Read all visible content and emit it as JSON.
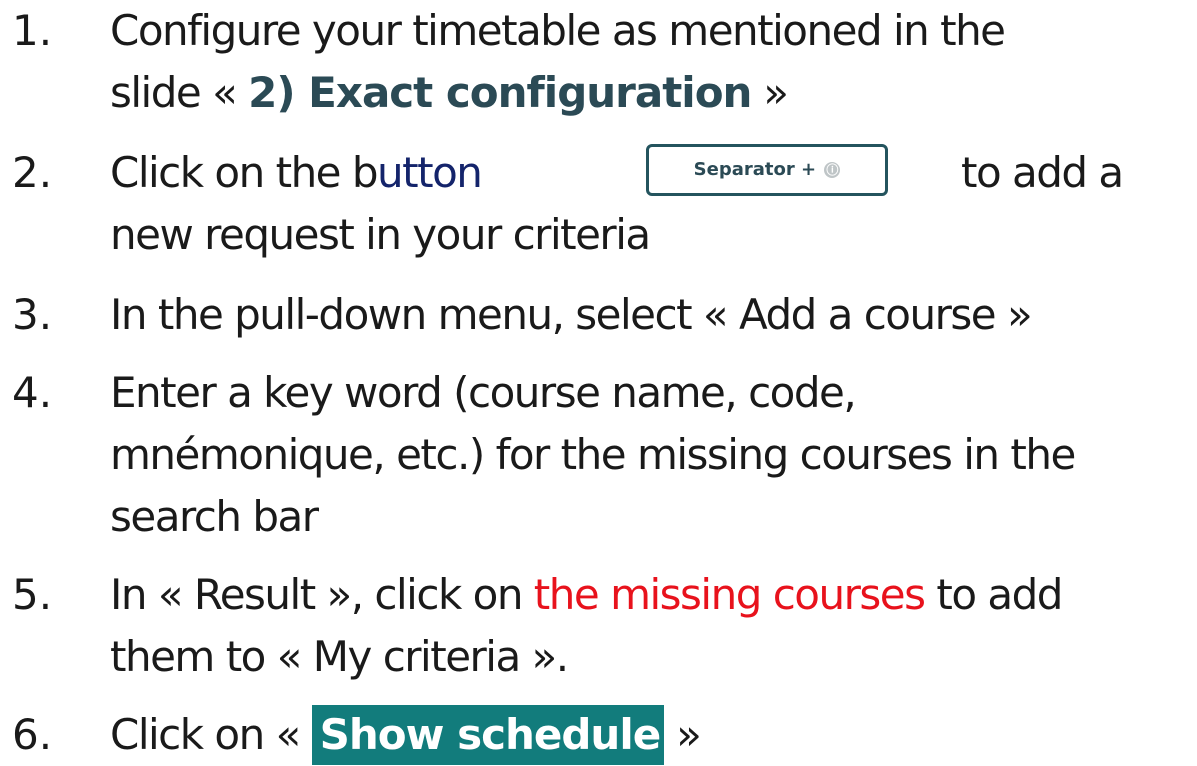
{
  "steps": [
    {
      "number": "1.",
      "line1": "Configure your timetable as mentioned in the",
      "line2_prefix": "slide « ",
      "line2_bold": "2) Exact configuration",
      "line2_suffix": " »"
    },
    {
      "number": "2.",
      "prefix": "Click on the b",
      "prefix_colored": "utton",
      "button_label": "Separator +",
      "info_icon": "ⓘ",
      "suffix": "to add a",
      "line2": "new request in your criteria"
    },
    {
      "number": "3.",
      "line1": "In the pull-down menu, select « Add a course »"
    },
    {
      "number": "4.",
      "line1": "Enter a key word (course name, code,",
      "line2": "mnémonique, etc.) for the missing courses in the",
      "line3": "search bar"
    },
    {
      "number": "5.",
      "prefix": "In « Result », click on ",
      "highlight": "the missing courses",
      "suffix": " to add",
      "line2": "them to « My criteria »."
    },
    {
      "number": "6.",
      "prefix": "Click on « ",
      "button_label": "Show schedule",
      "suffix": " »"
    }
  ],
  "colors": {
    "teal_text": "#2b4a55",
    "navy_text": "#14246b",
    "red_highlight": "#e8121c",
    "button_teal": "#127c7c"
  }
}
